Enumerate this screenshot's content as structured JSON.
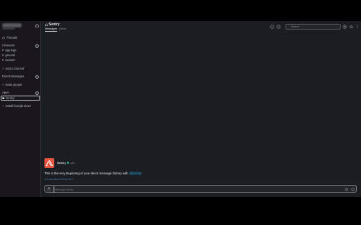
{
  "colors": {
    "brand_avatar": "#e8543f",
    "link": "#1d9bd1",
    "presence": "#2bac76",
    "sidebar_bg": "#19171d",
    "main_bg": "#1a1d21"
  },
  "sidebar": {
    "threads_label": "Threads",
    "channels_heading": "Channels",
    "channels": [
      "app-logs",
      "general",
      "random"
    ],
    "add_channel_label": "Add a channel",
    "dm_heading": "Direct Messages",
    "invite_label": "Invite people",
    "apps_heading": "Apps",
    "apps": [
      "Sentry"
    ],
    "install_label": "Install Google Drive"
  },
  "header": {
    "title": "Sentry",
    "tabs": [
      "Messages",
      "About"
    ],
    "search_placeholder": "Search"
  },
  "conversation": {
    "bot_name": "Sentry",
    "bot_badge": "APP",
    "intro_text": "This is the very beginning of your direct message history with",
    "intro_mention": "@Sentry",
    "learn_more": "Learn about Sentry here"
  },
  "composer": {
    "placeholder": "Message Sentry"
  }
}
